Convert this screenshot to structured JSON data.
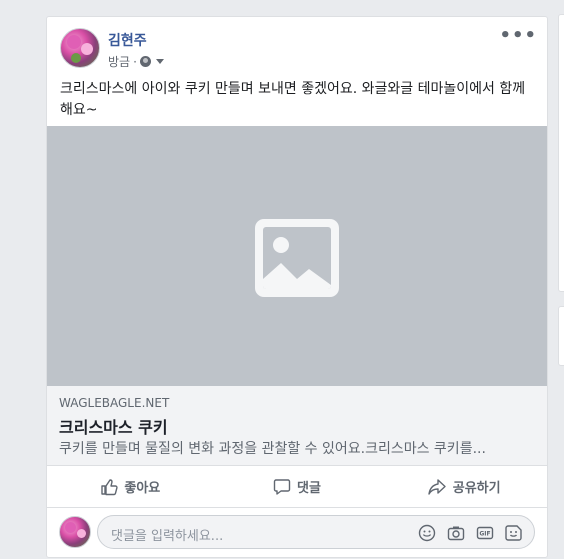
{
  "post": {
    "author": "김현주",
    "timestamp": "방금",
    "visibility_icon": "globe-icon",
    "text": "크리스마스에 아이와 쿠키 만들며 보내면 좋겠어요. 와글와글 테마놀이에서 함께 해요~"
  },
  "link_preview": {
    "image_icon": "image-placeholder-icon",
    "domain": "WAGLEBAGLE.NET",
    "title": "크리스마스 쿠키",
    "description": "쿠키를 만들며 물질의 변화 과정을 관찰할 수 있어요.크리스마스 쿠키를..."
  },
  "actions": {
    "like": "좋아요",
    "comment": "댓글",
    "share": "공유하기"
  },
  "comment_box": {
    "placeholder": "댓글을 입력하세요..."
  },
  "colors": {
    "author": "#385898",
    "background": "#e9ebee",
    "image_placeholder": "#bec3c9"
  }
}
